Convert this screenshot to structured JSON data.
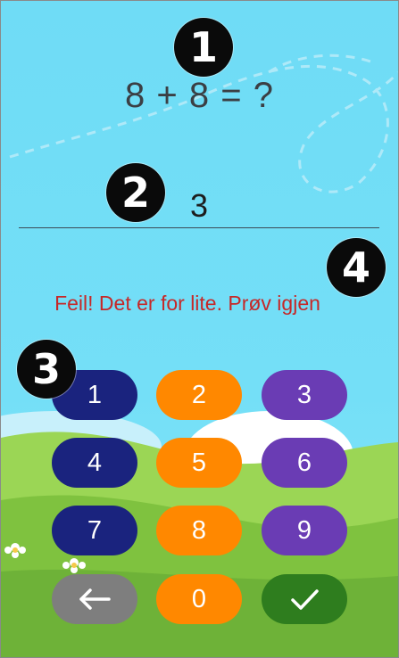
{
  "markers": [
    "1",
    "2",
    "3",
    "4"
  ],
  "question": "8 + 8 = ?",
  "answer": "3",
  "feedback": "Feil! Det er for lite. Prøv igjen",
  "keypad": {
    "keys": [
      "1",
      "2",
      "3",
      "4",
      "5",
      "6",
      "7",
      "8",
      "9",
      "0"
    ],
    "backspace_icon": "arrow-left-icon",
    "confirm_icon": "checkmark-icon"
  },
  "colors": {
    "sky": "#74dff7",
    "grass": "#8fd44a",
    "key_navy": "#1a237e",
    "key_orange": "#ff8800",
    "key_purple": "#6a3cb4",
    "key_grey": "#7e7e7e",
    "key_green": "#2e7d1e",
    "error_text": "#c62828"
  }
}
